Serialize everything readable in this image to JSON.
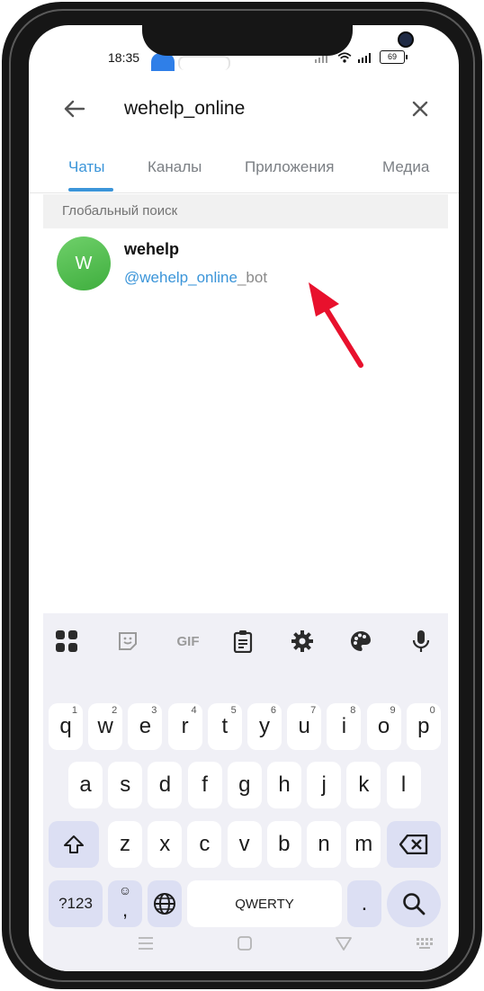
{
  "statusbar": {
    "time": "18:35",
    "battery": "69"
  },
  "search": {
    "query": "wehelp_online"
  },
  "tabs": [
    {
      "label": "Чаты",
      "active": true
    },
    {
      "label": "Каналы",
      "active": false
    },
    {
      "label": "Приложения",
      "active": false
    },
    {
      "label": "Медиа",
      "active": false
    }
  ],
  "section_header": "Глобальный поиск",
  "result": {
    "avatar_letter": "W",
    "name": "wehelp",
    "username_match": "@wehelp_online",
    "username_rest": "_bot"
  },
  "keyboard": {
    "toolbar": [
      "apps-grid-icon",
      "sticker-icon",
      "GIF",
      "clipboard-icon",
      "settings-gear-icon",
      "palette-icon",
      "microphone-icon"
    ],
    "row1": [
      {
        "k": "q",
        "h": "1"
      },
      {
        "k": "w",
        "h": "2"
      },
      {
        "k": "e",
        "h": "3"
      },
      {
        "k": "r",
        "h": "4"
      },
      {
        "k": "t",
        "h": "5"
      },
      {
        "k": "y",
        "h": "6"
      },
      {
        "k": "u",
        "h": "7"
      },
      {
        "k": "i",
        "h": "8"
      },
      {
        "k": "o",
        "h": "9"
      },
      {
        "k": "p",
        "h": "0"
      }
    ],
    "row2": [
      "a",
      "s",
      "d",
      "f",
      "g",
      "h",
      "j",
      "k",
      "l"
    ],
    "row3": [
      "z",
      "x",
      "c",
      "v",
      "b",
      "n",
      "m"
    ],
    "symbols_label": "?123",
    "emoji_comma_label": ",",
    "space_label": "QWERTY",
    "period_label": "."
  },
  "colors": {
    "accent": "#3b95d9",
    "avatar": "#4cbb47",
    "arrow": "#e8112d"
  }
}
